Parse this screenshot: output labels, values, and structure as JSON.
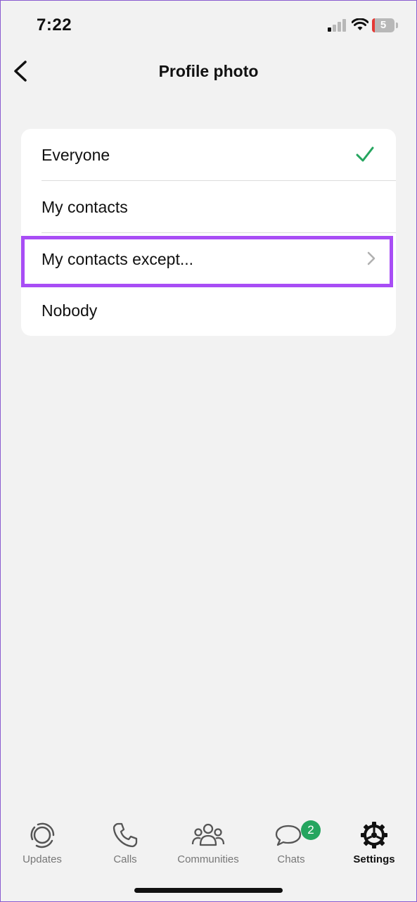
{
  "status_bar": {
    "time": "7:22",
    "battery_level": "5",
    "signal_icon": "cellular-signal-icon",
    "wifi_icon": "wifi-icon",
    "battery_icon": "battery-icon"
  },
  "nav": {
    "title": "Profile photo",
    "back_icon": "chevron-left-icon"
  },
  "options": [
    {
      "label": "Everyone",
      "selected": true,
      "accessory": "checkmark-icon"
    },
    {
      "label": "My contacts",
      "selected": false,
      "accessory": null
    },
    {
      "label": "My contacts except...",
      "selected": false,
      "accessory": "chevron-right-icon"
    },
    {
      "label": "Nobody",
      "selected": false,
      "accessory": null
    }
  ],
  "tab_bar": {
    "tabs": [
      {
        "label": "Updates",
        "icon": "updates-icon",
        "active": false
      },
      {
        "label": "Calls",
        "icon": "phone-icon",
        "active": false
      },
      {
        "label": "Communities",
        "icon": "communities-icon",
        "active": false
      },
      {
        "label": "Chats",
        "icon": "chats-icon",
        "active": false,
        "badge": "2"
      },
      {
        "label": "Settings",
        "icon": "gear-icon",
        "active": true
      }
    ]
  },
  "colors": {
    "background": "#f2f2f2",
    "card": "#ffffff",
    "check_green": "#25a55f",
    "highlight_purple": "#a84df5",
    "badge_green": "#25a55f"
  }
}
